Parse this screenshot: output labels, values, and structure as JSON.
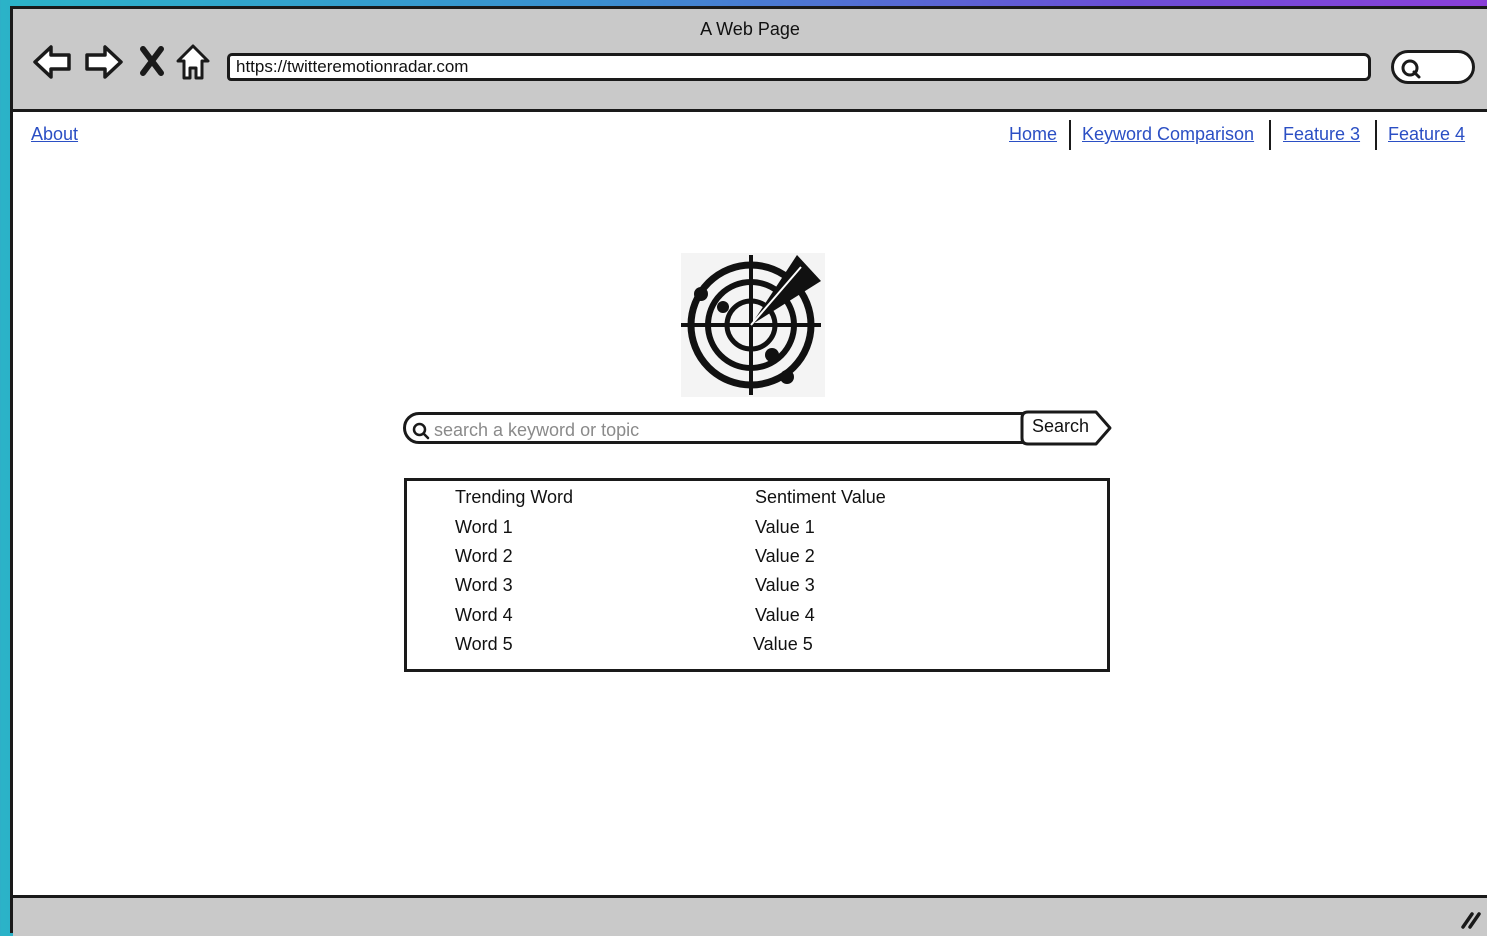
{
  "window": {
    "title": "A Web Page"
  },
  "browser": {
    "url": "https://twitteremotionradar.com",
    "nav_icons": [
      "back-arrow-icon",
      "forward-arrow-icon",
      "close-icon",
      "home-icon"
    ],
    "search_icon": "search-icon"
  },
  "topnav": {
    "left_link": "About",
    "right_links": [
      "Home",
      "Keyword Comparison",
      "Feature 3",
      "Feature 4"
    ]
  },
  "logo": {
    "icon": "radar-icon"
  },
  "search": {
    "placeholder": "search a keyword or topic",
    "button_label": "Search"
  },
  "table": {
    "headers": [
      "Trending Word",
      "Sentiment Value"
    ],
    "rows": [
      [
        "Word 1",
        "Value 1"
      ],
      [
        "Word 2",
        "Value 2"
      ],
      [
        "Word 3",
        "Value 3"
      ],
      [
        "Word 4",
        "Value 4"
      ],
      [
        "Word 5",
        "Value 5"
      ]
    ]
  },
  "colors": {
    "link": "#2b4fc4",
    "chrome": "#c9c9c9",
    "border": "#1a1a1a"
  }
}
